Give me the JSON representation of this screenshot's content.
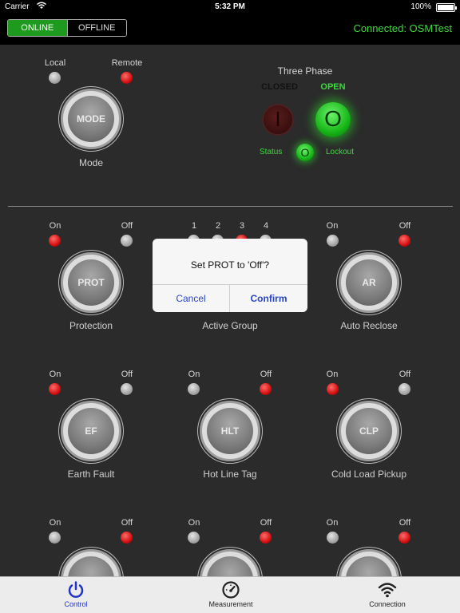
{
  "status_bar": {
    "carrier": "Carrier",
    "time": "5:32 PM",
    "battery": "100%"
  },
  "header": {
    "mode_online": "ONLINE",
    "mode_offline": "OFFLINE",
    "connection_status": "Connected: OSMTest"
  },
  "mode_panel": {
    "local_label": "Local",
    "remote_label": "Remote",
    "knob_label": "MODE",
    "caption": "Mode"
  },
  "three_phase": {
    "title": "Three Phase",
    "closed_label": "CLOSED",
    "open_label": "OPEN",
    "closed_symbol": "I",
    "open_symbol": "O",
    "lockout_symbol": "O",
    "status_label": "Status",
    "lockout_label": "Lockout"
  },
  "controls": {
    "prot": {
      "on": "On",
      "off": "Off",
      "knob": "PROT",
      "caption": "Protection"
    },
    "active_group": {
      "groups": [
        "1",
        "2",
        "3",
        "4"
      ],
      "caption": "Active Group"
    },
    "ar": {
      "on": "On",
      "off": "Off",
      "knob": "AR",
      "caption": "Auto Reclose"
    },
    "ef": {
      "on": "On",
      "off": "Off",
      "knob": "EF",
      "caption": "Earth Fault"
    },
    "hlt": {
      "on": "On",
      "off": "Off",
      "knob": "HLT",
      "caption": "Hot Line Tag"
    },
    "clp": {
      "on": "On",
      "off": "Off",
      "knob": "CLP",
      "caption": "Cold Load Pickup"
    },
    "row4": [
      {
        "on": "On",
        "off": "Off"
      },
      {
        "on": "On",
        "off": "Off"
      },
      {
        "on": "On",
        "off": "Off"
      }
    ]
  },
  "dialog": {
    "message": "Set PROT to 'Off'?",
    "cancel": "Cancel",
    "confirm": "Confirm"
  },
  "tabbar": {
    "tabs": [
      {
        "label": "Control",
        "icon": "power-icon",
        "active": true
      },
      {
        "label": "Measurement",
        "icon": "gauge-icon",
        "active": false
      },
      {
        "label": "Connection",
        "icon": "wifi-icon",
        "active": false
      }
    ]
  },
  "colors": {
    "accent_green": "#3fd83f",
    "led_red": "#d41010",
    "tab_active": "#2233cc"
  }
}
